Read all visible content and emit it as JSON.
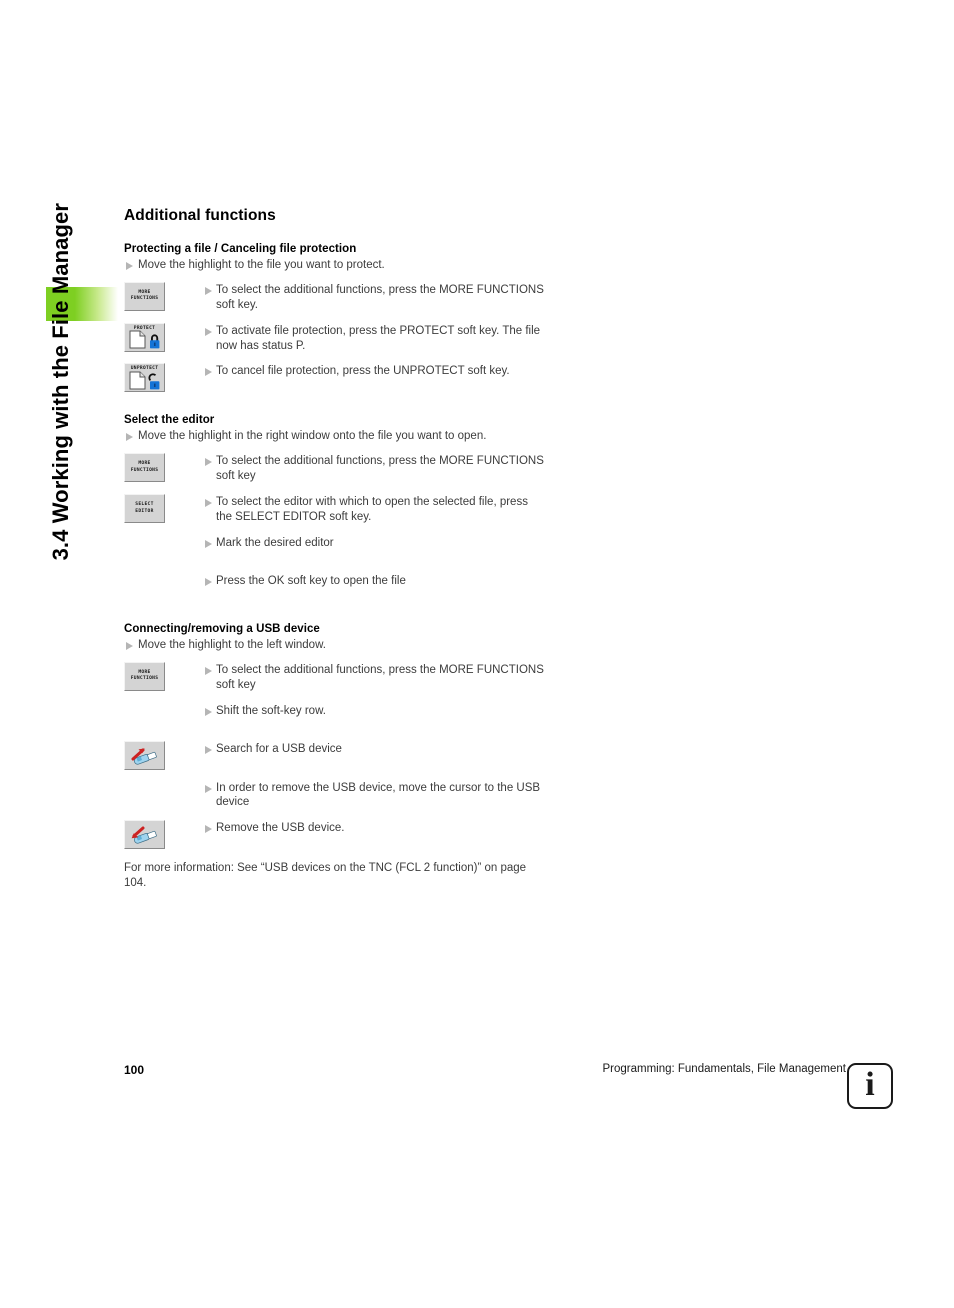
{
  "sidebar": {
    "chapter_title": "3.4 Working with the File Manager",
    "tab_color": "#7ECF22"
  },
  "content": {
    "section_title": "Additional functions",
    "blocks": [
      {
        "heading": "Protecting a file / Canceling file protection",
        "lead_bullet": "Move the highlight to the file you want to protect.",
        "rows": [
          {
            "softkey": {
              "label": "MORE\nFUNCTIONS",
              "icon": "none"
            },
            "text": "To select the additional functions, press the MORE FUNCTIONS soft key."
          },
          {
            "softkey": {
              "label": "PROTECT",
              "icon": "document-locked-icon"
            },
            "text": "To activate file protection, press the PROTECT soft key. The file now has status P."
          },
          {
            "softkey": {
              "label": "UNPROTECT",
              "icon": "document-unlocked-icon"
            },
            "text": "To cancel file protection, press the UNPROTECT soft key."
          }
        ]
      },
      {
        "heading": "Select the editor",
        "lead_bullet": "Move the highlight in the right window onto the file you want to open.",
        "rows": [
          {
            "softkey": {
              "label": "MORE\nFUNCTIONS",
              "icon": "none"
            },
            "text": "To select the additional functions, press the MORE FUNCTIONS soft key"
          },
          {
            "softkey": {
              "label": "SELECT\nEDITOR",
              "icon": "none"
            },
            "text": "To select the editor with which to open the selected file, press the SELECT EDITOR soft key."
          },
          {
            "softkey": null,
            "text": "Mark the desired editor"
          },
          {
            "softkey": null,
            "text": "Press the OK soft key to open the file"
          }
        ]
      },
      {
        "heading": "Connecting/removing a USB device",
        "lead_bullet": "Move the highlight to the left window.",
        "rows": [
          {
            "softkey": {
              "label": "MORE\nFUNCTIONS",
              "icon": "none"
            },
            "text": "To select the additional functions, press the MORE FUNCTIONS soft key"
          },
          {
            "softkey": null,
            "text": "Shift the soft-key row."
          },
          {
            "softkey": {
              "label": "",
              "icon": "usb-connect-icon"
            },
            "text": "Search for a USB device"
          },
          {
            "softkey": null,
            "text": "In order to remove the USB device, move the cursor to the USB device"
          },
          {
            "softkey": {
              "label": "",
              "icon": "usb-remove-icon"
            },
            "text": "Remove the USB device."
          }
        ]
      }
    ],
    "note": "For more information: See “USB devices on the TNC (FCL 2 function)” on page 104."
  },
  "footer": {
    "page_number": "100",
    "caption": "Programming: Fundamentals, File Management",
    "info_glyph": "i",
    "info_icon_name": "info-icon"
  }
}
